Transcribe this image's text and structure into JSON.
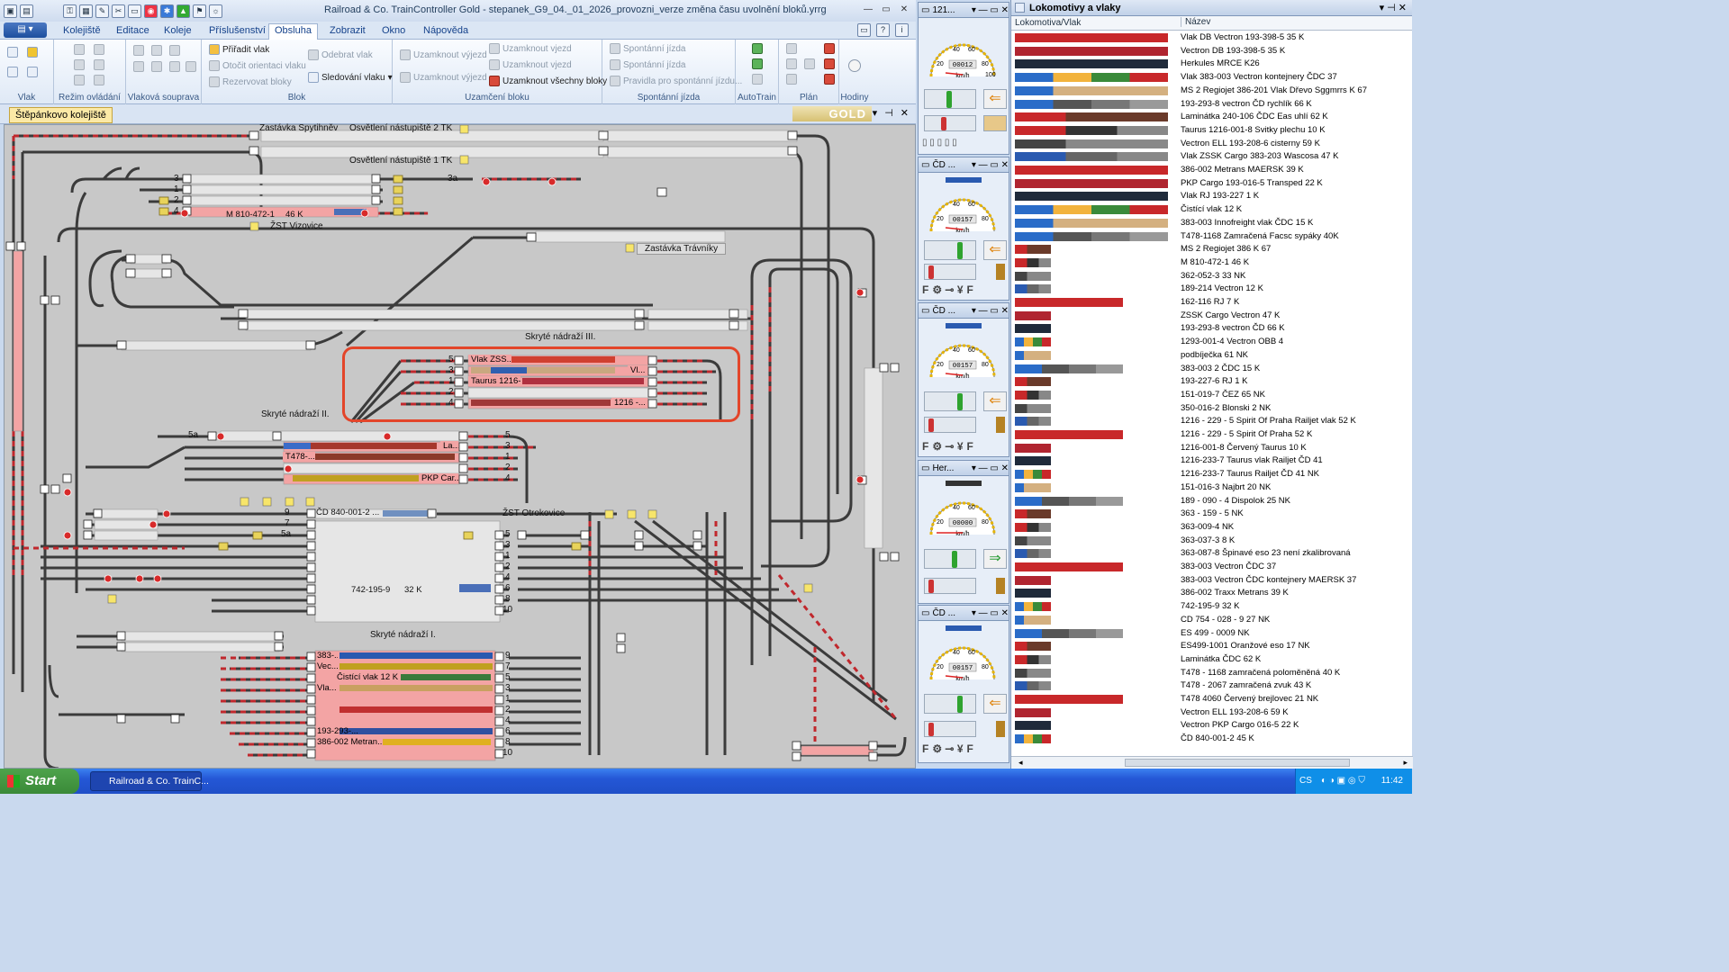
{
  "window": {
    "title": "Railroad & Co. TrainController Gold - stepanek_G9_04._01_2026_provozni_verze změna času uvolnění bloků.yrrg"
  },
  "tabs": [
    "Kolejiště",
    "Editace",
    "Koleje",
    "Příslušenství",
    "Obsluha",
    "Zobrazit",
    "Okno",
    "Nápověda"
  ],
  "active_tab": "Obsluha",
  "ribbon": {
    "groups": [
      {
        "label": "Vlak"
      },
      {
        "label": "Režim ovládání"
      },
      {
        "label": "Vlaková souprava"
      },
      {
        "label": "Blok",
        "buttons": [
          "Přiřadit vlak",
          "Otočit orientaci vlaku",
          "Rezervovat bloky",
          "Odebrat vlak",
          "Sledování vlaku"
        ]
      },
      {
        "label": "Uzamčení bloku",
        "buttons": [
          "Uzamknout výjezd",
          "Uzamknout výjezd",
          "Uzamknout vjezd",
          "Uzamknout vjezd",
          "Uzamknout všechny bloky"
        ]
      },
      {
        "label": "Spontánní jízda",
        "buttons": [
          "Spontánní jízda",
          "Spontánní jízda",
          "Pravidla pro spontánní jízdu..."
        ]
      },
      {
        "label": "AutoTrain"
      },
      {
        "label": "Plán"
      },
      {
        "label": "Hodiny"
      }
    ]
  },
  "doc_tab": "Štěpánkovo kolejiště",
  "gold_logo": "GOLD",
  "layout_labels": {
    "zastavka_spytihnev": "Zastávka Spytihněv",
    "osvetleni2": "Osvětlení nástupiště 2 TK",
    "osvetleni1": "Osvětlení nástupiště 1 TK",
    "zst_vizovice": "ŽST Vizovice",
    "zastavka_travniky": "Zastávka Trávníky",
    "skryte3": "Skryté nádraží III.",
    "skryte2": "Skryté nádraží II.",
    "zst_otrokovice": "ŽST Otrokovice",
    "skryte1": "Skryté nádraží I.",
    "m810": "M 810-472-1",
    "m810k": "46 K",
    "cd840": "ČD 840-001-2 ...",
    "t742": "742-195-9",
    "t742k": "32 K"
  },
  "track_numbers": {
    "vizovice": [
      "3",
      "1",
      "2",
      "4"
    ],
    "vizovice_3a": "3a",
    "s3": [
      "5",
      "3",
      "1",
      "2",
      "4"
    ],
    "s2": [
      "5a",
      "5",
      "3",
      "1",
      "2",
      "4"
    ],
    "otrokovice_left": [
      "9",
      "7",
      "5a"
    ],
    "otrokovice": [
      "5",
      "3",
      "1",
      "2",
      "4",
      "6",
      "8",
      "10"
    ],
    "s1": [
      "9",
      "7",
      "5",
      "3",
      "1",
      "2",
      "4",
      "6",
      "8",
      "10"
    ]
  },
  "trains_s3": [
    "Vlak ZSS...",
    "Vl...",
    "Taurus 1216-...",
    "",
    "1216 -..."
  ],
  "trains_s2": [
    "La...",
    "T478-...",
    "",
    "PKP Car..."
  ],
  "trains_s1": [
    "383-...",
    "Vec...",
    "Čistící vlak 12 K",
    "Vla...",
    "",
    "",
    "193-293-...",
    "386-002 Metran..."
  ],
  "engines": [
    {
      "title": "121...",
      "speed": "00012",
      "unit": "km/h",
      "arrow": "⇐",
      "arrow_color": "#e08a1a"
    },
    {
      "title": "ČD ...",
      "speed": "00157",
      "unit": "km/h",
      "arrow": "⇐",
      "arrow_color": "#e08a1a"
    },
    {
      "title": "ČD ...",
      "speed": "00157",
      "unit": "km/h",
      "arrow": "⇐",
      "arrow_color": "#e08a1a"
    },
    {
      "title": "Her...",
      "speed": "00000",
      "unit": "km/h",
      "arrow": "⇒",
      "arrow_color": "#2f9e3a"
    },
    {
      "title": "ČD ...",
      "speed": "00157",
      "unit": "km/h",
      "arrow": "⇐",
      "arrow_color": "#e08a1a"
    }
  ],
  "gauge_ticks": [
    "20",
    "40",
    "60",
    "80",
    "100"
  ],
  "function_keys": [
    "F",
    "F"
  ],
  "loco_panel": {
    "title": "Lokomotivy a vlaky",
    "col1": "Lokomotiva/Vlak",
    "col2": "Název",
    "rows": [
      "Vlak DB Vectron 193-398-5   35 K",
      "Vectron  DB 193-398-5   35 K",
      "Herkules MRCE K26",
      "Vlak 383-003 Vectron kontejnery ČDC 37",
      "MS 2 Regiojet 386-201 Vlak Dřevo Sggmrrs  K 67",
      "193-293-8 vectron ČD rychlík 66 K",
      "Laminátka 240-106  ČDC Eas uhlí  62 K",
      "Taurus 1216-001-8  Svitky plechu 10 K",
      "Vectron ELL 193-208-6 cisterny   59 K",
      "Vlak ZSSK Cargo 383-203 Wascosa   47 K",
      "386-002 Metrans MAERSK    39 K",
      "PKP Cargo 193-016-5    Transped   22 K",
      "Vlak RJ 193-227  1 K",
      "Čistící vlak 12 K",
      "383-003 Innofreight vlak  ČDC 15 K",
      "T478-1168 Zamračená Facsc sypáky 40K",
      "MS 2 Regiojet  386  K  67",
      "M 810-472-1       46 K",
      "362-052-3 33 NK",
      "189-214 Vectron 12 K",
      "162-116 RJ  7 K",
      "ZSSK Cargo  Vectron   47 K",
      "193-293-8 vectron ČD    66 K",
      "1293-001-4 Vectron OBB 4",
      "podbíječka 61 NK",
      "383-003  2  ČDC 15 K",
      "193-227-6 RJ  1 K",
      "151-019-7 ČEZ 65 NK",
      "350-016-2 Blonski  2 NK",
      "1216 - 229 - 5 Spirit Of Praha Railjet vlak   52  K",
      "1216 - 229 - 5 Spirit Of Praha   52  K",
      "1216-001-8 Červený Taurus     10 K",
      "1216-233-7 Taurus  vlak Railjet ČD    41",
      "1216-233-7 Taurus Railjet ČD     41 NK",
      "151-016-3 Najbrt        20 NK",
      "189 - 090 - 4 Dispolok  25 NK",
      "363 - 159 - 5 NK",
      "363-009-4 NK",
      "363-037-3       8 K",
      "363-087-8 Špinavé eso 23 není zkalibrovaná",
      "383-003 Vectron ČDC 37",
      "383-003 Vectron ČDC kontejnery MAERSK 37",
      "386-002 Traxx Metrans      39 K",
      "742-195-9         32 K",
      "CD 754 - 028 - 9    27 NK",
      "ES 499 - 0009 NK",
      "ES499-1001  Oranžové eso      17 NK",
      "Laminátka ČDC   62 K",
      "T478 - 1168 zamračená poloměněná 40 K",
      "T478 - 2067 zamračená zvuk 43 K",
      "T478 4060 Červený brejlovec 21 NK",
      "Vectron ELL 193-208-6      59 K",
      "Vectron PKP Cargo 016-5       22 K",
      "ČD 840-001-2  45 K"
    ]
  },
  "taskbar": {
    "start": "Start",
    "task": "Railroad & Co. TrainC...",
    "lang": "CS",
    "clock": "11:42"
  },
  "colors": {
    "accent": "#e3452a",
    "track": "#3a3a3a",
    "block": "#e8e8e8",
    "occupied": "#f4a0a0"
  }
}
